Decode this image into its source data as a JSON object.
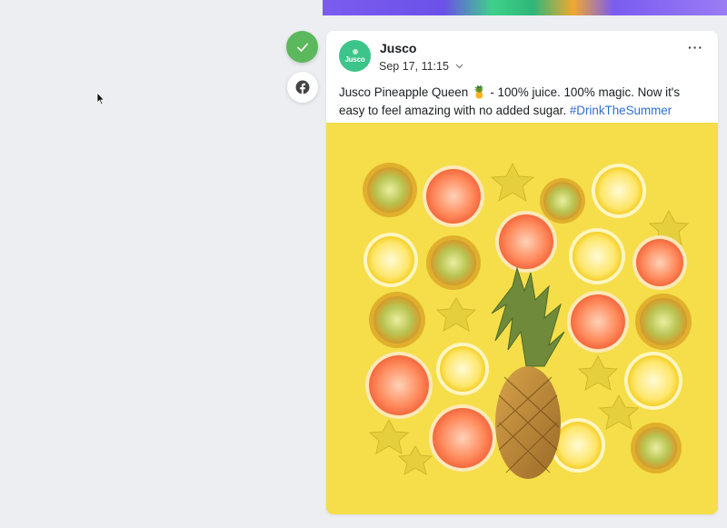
{
  "post": {
    "page_name": "Jusco",
    "avatar_text": "Jusco",
    "date": "Sep 17, 11:15",
    "text_prefix": "Jusco Pineapple Queen",
    "emoji": "🍍",
    "text_main": " - 100% juice. 100% magic. Now it's easy to feel amazing with no added sugar. ",
    "hashtag": "#DrinkTheSummer",
    "more_label": "···"
  },
  "sidebar": {
    "status_icon": "check-icon",
    "network_icon": "facebook-icon"
  },
  "colors": {
    "approved": "#5cb85c",
    "brand": "#3dc48a",
    "link": "#2f6fcf",
    "image_bg": "#f5de4a"
  }
}
